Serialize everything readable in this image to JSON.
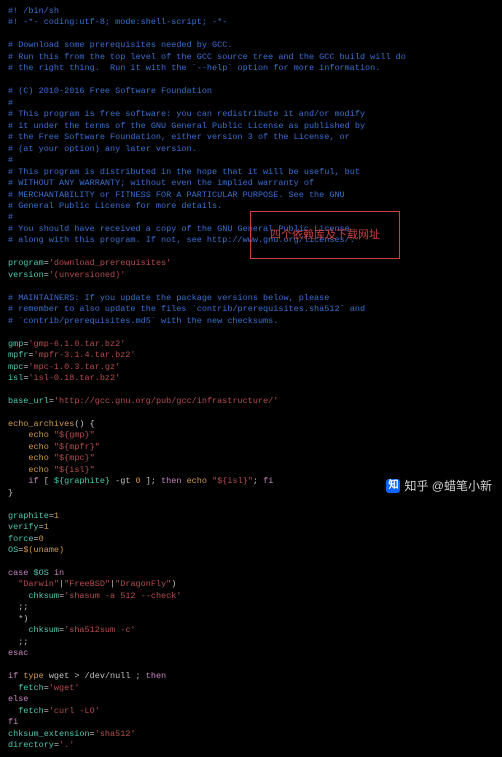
{
  "callout_text": "四个依赖库及下载网址",
  "watermark": {
    "icon": "知",
    "text": "知乎 @蜡笔小新"
  },
  "code": [
    [
      [
        "c-comment",
        "#! /bin/sh"
      ]
    ],
    [
      [
        "c-comment",
        "#! -*- coding:utf-8; mode:shell-script; -*-"
      ]
    ],
    [
      [
        "c-comment",
        ""
      ]
    ],
    [
      [
        "c-comment",
        "# Download some prerequisites needed by GCC."
      ]
    ],
    [
      [
        "c-comment",
        "# Run this from the top level of the GCC source tree and the GCC build will do"
      ]
    ],
    [
      [
        "c-comment",
        "# the right thing.  Run it with the `--help` option for more information."
      ]
    ],
    [
      [
        "c-comment",
        ""
      ]
    ],
    [
      [
        "c-comment",
        "# (C) 2010-2016 Free Software Foundation"
      ]
    ],
    [
      [
        "c-comment",
        "#"
      ]
    ],
    [
      [
        "c-comment",
        "# This program is free software: you can redistribute it and/or modify"
      ]
    ],
    [
      [
        "c-comment",
        "# it under the terms of the GNU General Public License as published by"
      ]
    ],
    [
      [
        "c-comment",
        "# the Free Software Foundation, either version 3 of the License, or"
      ]
    ],
    [
      [
        "c-comment",
        "# (at your option) any later version."
      ]
    ],
    [
      [
        "c-comment",
        "#"
      ]
    ],
    [
      [
        "c-comment",
        "# This program is distributed in the hope that it will be useful, but"
      ]
    ],
    [
      [
        "c-comment",
        "# WITHOUT ANY WARRANTY; without even the implied warranty of"
      ]
    ],
    [
      [
        "c-comment",
        "# MERCHANTABILITY or FITNESS FOR A PARTICULAR PURPOSE. See the GNU"
      ]
    ],
    [
      [
        "c-comment",
        "# General Public License for more details."
      ]
    ],
    [
      [
        "c-comment",
        "#"
      ]
    ],
    [
      [
        "c-comment",
        "# You should have received a copy of the GNU General Public License"
      ]
    ],
    [
      [
        "c-comment",
        "# along with this program. If not, see http://www.gnu.org/licenses/."
      ]
    ],
    [
      [
        "c-comment",
        ""
      ]
    ],
    [
      [
        "c-var",
        "program"
      ],
      [
        "c-op",
        "="
      ],
      [
        "c-str",
        "'download_prerequisites'"
      ]
    ],
    [
      [
        "c-var",
        "version"
      ],
      [
        "c-op",
        "="
      ],
      [
        "c-str",
        "'(unversioned)'"
      ]
    ],
    [
      [
        "c-comment",
        ""
      ]
    ],
    [
      [
        "c-comment",
        "# MAINTAINERS: If you update the package versions below, please"
      ]
    ],
    [
      [
        "c-comment",
        "# remember to also update the files `contrib/prerequisites.sha512` and"
      ]
    ],
    [
      [
        "c-comment",
        "# `contrib/prerequisites.md5` with the new checksums."
      ]
    ],
    [
      [
        "c-comment",
        ""
      ]
    ],
    [
      [
        "c-var",
        "gmp"
      ],
      [
        "c-op",
        "="
      ],
      [
        "c-str",
        "'gmp-6.1.0.tar.bz2'"
      ]
    ],
    [
      [
        "c-var",
        "mpfr"
      ],
      [
        "c-op",
        "="
      ],
      [
        "c-str",
        "'mpfr-3.1.4.tar.bz2'"
      ]
    ],
    [
      [
        "c-var",
        "mpc"
      ],
      [
        "c-op",
        "="
      ],
      [
        "c-str",
        "'mpc-1.0.3.tar.gz'"
      ]
    ],
    [
      [
        "c-var",
        "isl"
      ],
      [
        "c-op",
        "="
      ],
      [
        "c-str",
        "'isl-0.18.tar.bz2'"
      ]
    ],
    [
      [
        "c-comment",
        ""
      ]
    ],
    [
      [
        "c-var",
        "base_url"
      ],
      [
        "c-op",
        "="
      ],
      [
        "c-str",
        "'http://gcc.gnu.org/pub/gcc/infrastructure/'"
      ]
    ],
    [
      [
        "c-comment",
        ""
      ]
    ],
    [
      [
        "c-func",
        "echo_archives"
      ],
      [
        "c-plain",
        "() {"
      ]
    ],
    [
      [
        "c-plain",
        "    "
      ],
      [
        "c-func",
        "echo"
      ],
      [
        "c-plain",
        " "
      ],
      [
        "c-str",
        "\"${gmp}\""
      ]
    ],
    [
      [
        "c-plain",
        "    "
      ],
      [
        "c-func",
        "echo"
      ],
      [
        "c-plain",
        " "
      ],
      [
        "c-str",
        "\"${mpfr}\""
      ]
    ],
    [
      [
        "c-plain",
        "    "
      ],
      [
        "c-func",
        "echo"
      ],
      [
        "c-plain",
        " "
      ],
      [
        "c-str",
        "\"${mpc}\""
      ]
    ],
    [
      [
        "c-plain",
        "    "
      ],
      [
        "c-func",
        "echo"
      ],
      [
        "c-plain",
        " "
      ],
      [
        "c-str",
        "\"${isl}\""
      ]
    ],
    [
      [
        "c-plain",
        "    "
      ],
      [
        "c-kw",
        "if"
      ],
      [
        "c-plain",
        " [ "
      ],
      [
        "c-var",
        "${graphite}"
      ],
      [
        "c-plain",
        " -gt "
      ],
      [
        "c-func",
        "0"
      ],
      [
        "c-plain",
        " ]; "
      ],
      [
        "c-kw",
        "then"
      ],
      [
        "c-plain",
        " "
      ],
      [
        "c-func",
        "echo"
      ],
      [
        "c-plain",
        " "
      ],
      [
        "c-str",
        "\"${isl}\""
      ],
      [
        "c-plain",
        "; "
      ],
      [
        "c-kw",
        "fi"
      ]
    ],
    [
      [
        "c-plain",
        "}"
      ]
    ],
    [
      [
        "c-comment",
        ""
      ]
    ],
    [
      [
        "c-var",
        "graphite"
      ],
      [
        "c-op",
        "="
      ],
      [
        "c-func",
        "1"
      ]
    ],
    [
      [
        "c-var",
        "verify"
      ],
      [
        "c-op",
        "="
      ],
      [
        "c-func",
        "1"
      ]
    ],
    [
      [
        "c-var",
        "force"
      ],
      [
        "c-op",
        "="
      ],
      [
        "c-func",
        "0"
      ]
    ],
    [
      [
        "c-var",
        "OS"
      ],
      [
        "c-op",
        "="
      ],
      [
        "c-func",
        "$(uname)"
      ]
    ],
    [
      [
        "c-comment",
        ""
      ]
    ],
    [
      [
        "c-kw",
        "case"
      ],
      [
        "c-plain",
        " "
      ],
      [
        "c-var",
        "$OS"
      ],
      [
        "c-plain",
        " "
      ],
      [
        "c-kw",
        "in"
      ]
    ],
    [
      [
        "c-plain",
        "  "
      ],
      [
        "c-str",
        "\"Darwin\""
      ],
      [
        "c-plain",
        "|"
      ],
      [
        "c-str",
        "\"FreeBSD\""
      ],
      [
        "c-plain",
        "|"
      ],
      [
        "c-str",
        "\"DragonFly\""
      ],
      [
        "c-plain",
        ")"
      ]
    ],
    [
      [
        "c-plain",
        "    "
      ],
      [
        "c-var",
        "chksum"
      ],
      [
        "c-op",
        "="
      ],
      [
        "c-str",
        "'shasum -a 512 --check'"
      ]
    ],
    [
      [
        "c-plain",
        "  ;;"
      ]
    ],
    [
      [
        "c-plain",
        "  *)"
      ]
    ],
    [
      [
        "c-plain",
        "    "
      ],
      [
        "c-var",
        "chksum"
      ],
      [
        "c-op",
        "="
      ],
      [
        "c-str",
        "'sha512sum -c'"
      ]
    ],
    [
      [
        "c-plain",
        "  ;;"
      ]
    ],
    [
      [
        "c-kw",
        "esac"
      ]
    ],
    [
      [
        "c-comment",
        ""
      ]
    ],
    [
      [
        "c-kw",
        "if"
      ],
      [
        "c-plain",
        " "
      ],
      [
        "c-func",
        "type"
      ],
      [
        "c-plain",
        " wget > /dev/null ; "
      ],
      [
        "c-kw",
        "then"
      ]
    ],
    [
      [
        "c-plain",
        "  "
      ],
      [
        "c-var",
        "fetch"
      ],
      [
        "c-op",
        "="
      ],
      [
        "c-str",
        "'wget'"
      ]
    ],
    [
      [
        "c-kw",
        "else"
      ]
    ],
    [
      [
        "c-plain",
        "  "
      ],
      [
        "c-var",
        "fetch"
      ],
      [
        "c-op",
        "="
      ],
      [
        "c-str",
        "'curl -LO'"
      ]
    ],
    [
      [
        "c-kw",
        "fi"
      ]
    ],
    [
      [
        "c-var",
        "chksum_extension"
      ],
      [
        "c-op",
        "="
      ],
      [
        "c-str",
        "'sha512'"
      ]
    ],
    [
      [
        "c-var",
        "directory"
      ],
      [
        "c-op",
        "="
      ],
      [
        "c-str",
        "'.'"
      ]
    ]
  ]
}
